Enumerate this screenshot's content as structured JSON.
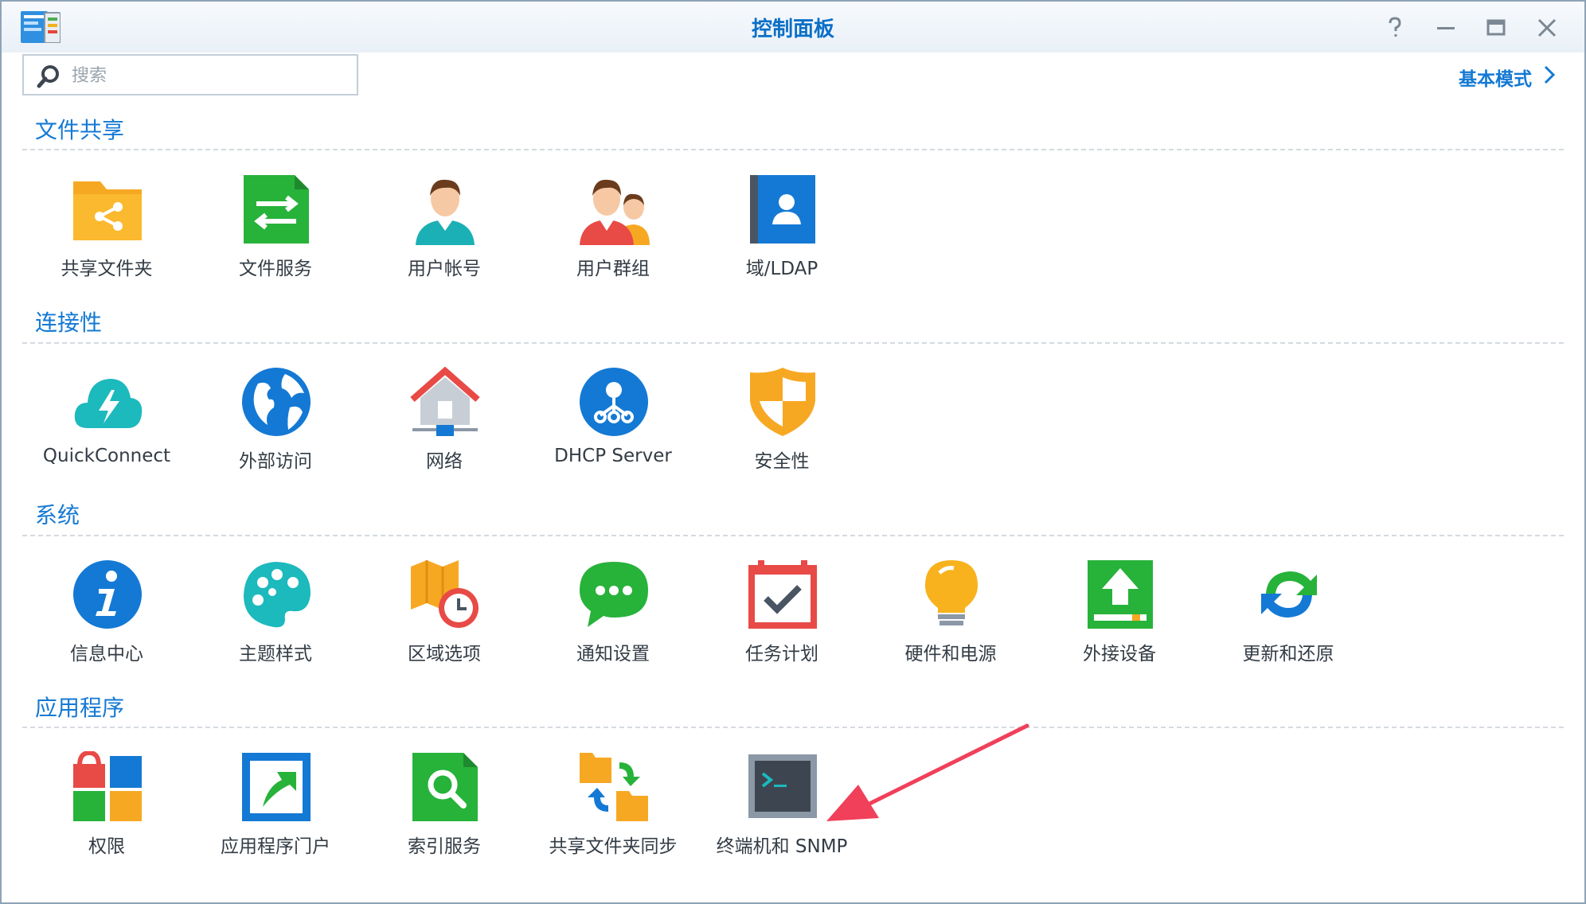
{
  "window": {
    "title": "控制面板"
  },
  "search": {
    "placeholder": "搜索",
    "value": ""
  },
  "mode_link": "基本模式",
  "sections": [
    {
      "title": "文件共享",
      "items": [
        "共享文件夹",
        "文件服务",
        "用户帐号",
        "用户群组",
        "域/LDAP"
      ]
    },
    {
      "title": "连接性",
      "items": [
        "QuickConnect",
        "外部访问",
        "网络",
        "DHCP Server",
        "安全性"
      ]
    },
    {
      "title": "系统",
      "items": [
        "信息中心",
        "主题样式",
        "区域选项",
        "通知设置",
        "任务计划",
        "硬件和电源",
        "外接设备",
        "更新和还原"
      ]
    },
    {
      "title": "应用程序",
      "items": [
        "权限",
        "应用程序门户",
        "索引服务",
        "共享文件夹同步",
        "终端机和 SNMP"
      ]
    }
  ],
  "colors": {
    "accent": "#1479d4",
    "arrow": "#f0405a"
  },
  "icons": {
    "titlebar": [
      "help-icon",
      "minimize-icon",
      "maximize-icon",
      "close-icon"
    ]
  }
}
